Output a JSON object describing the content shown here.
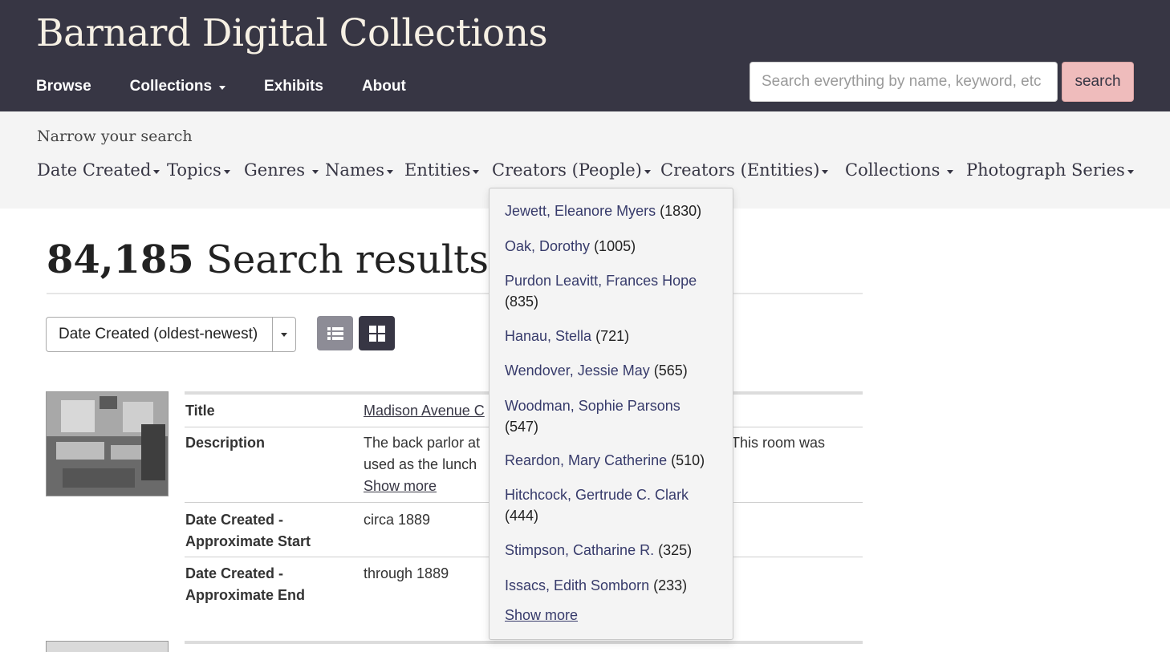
{
  "header": {
    "site_title": "Barnard Digital Collections",
    "nav": [
      "Browse",
      "Collections",
      "Exhibits",
      "About"
    ],
    "search_placeholder": "Search everything by name, keyword, etc",
    "search_button": "search"
  },
  "facet_bar": {
    "heading": "Narrow your search",
    "facets": [
      "Date Created",
      "Topics",
      "Genres",
      "Names",
      "Entities",
      "Creators (People)",
      "Creators (Entities)",
      "Collections",
      "Photograph Series"
    ]
  },
  "results": {
    "count": "84,185",
    "label": " Search results",
    "sort_label": "Date Created (oldest-newest)"
  },
  "record": {
    "title_label": "Title",
    "title_value": "Madison Avenue C",
    "description_label": "Description",
    "description_line1": "The back parlor at",
    "description_line1_right": "This room was",
    "description_line2": "used as the lunch",
    "show_more": "Show more",
    "date_start_label_1": "Date Created -",
    "date_start_label_2": "Approximate Start",
    "date_start_value": "circa 1889",
    "date_end_label_1": "Date Created -",
    "date_end_label_2": "Approximate End",
    "date_end_value": "through 1889"
  },
  "creators_dropdown": {
    "items": [
      {
        "name": "Jewett, Eleanore Myers",
        "count": "(1830)"
      },
      {
        "name": "Oak, Dorothy",
        "count": "(1005)"
      },
      {
        "name": "Purdon Leavitt, Frances Hope",
        "count": "(835)"
      },
      {
        "name": "Hanau, Stella",
        "count": "(721)"
      },
      {
        "name": "Wendover, Jessie May",
        "count": "(565)"
      },
      {
        "name": "Woodman, Sophie Parsons",
        "count": "(547)"
      },
      {
        "name": "Reardon, Mary Catherine",
        "count": "(510)"
      },
      {
        "name": "Hitchcock, Gertrude C. Clark",
        "count": "(444)"
      },
      {
        "name": "Stimpson, Catharine R.",
        "count": "(325)"
      },
      {
        "name": "Issacs, Edith Somborn",
        "count": "(233)"
      }
    ],
    "show_more": "Show more"
  },
  "colors": {
    "header_bg": "#373644",
    "search_button_bg": "#efbcbc",
    "facet_bar_bg": "#f4f4f4",
    "link": "#373b6b"
  }
}
